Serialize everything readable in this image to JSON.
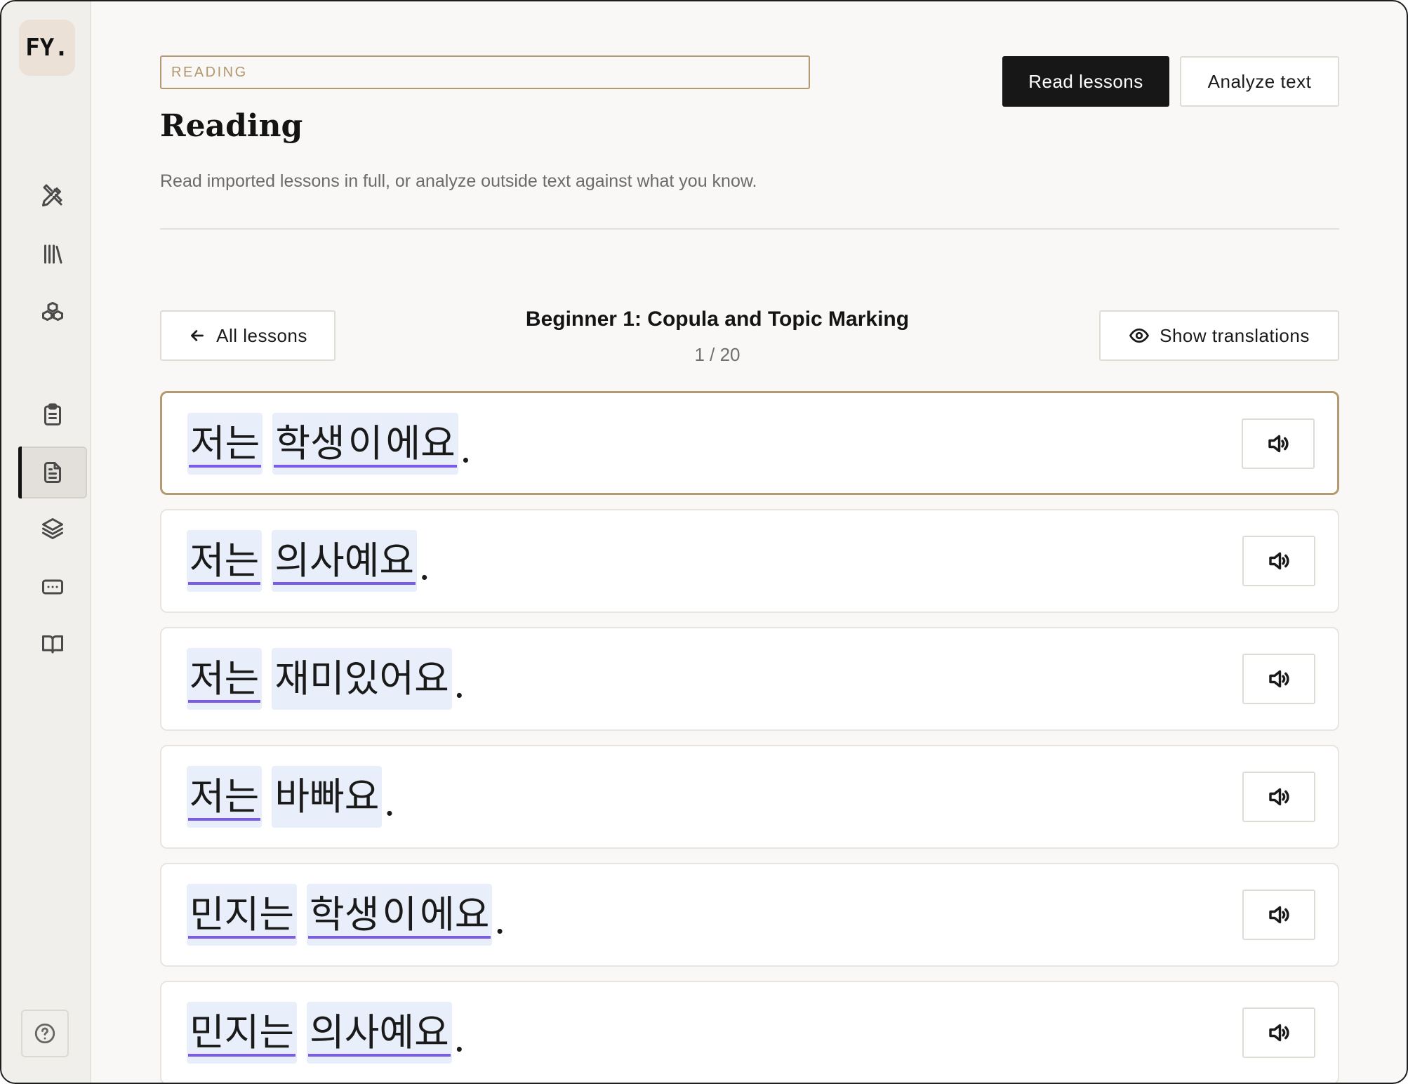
{
  "app": {
    "logo_text": "FY."
  },
  "sidebar": {
    "items": [
      {
        "icon": "pencil-ruler-icon",
        "active": false
      },
      {
        "icon": "library-icon",
        "active": false
      },
      {
        "icon": "boxes-icon",
        "active": false
      },
      {
        "icon": "clipboard-icon",
        "active": false
      },
      {
        "icon": "document-icon",
        "active": true
      },
      {
        "icon": "layers-icon",
        "active": false
      },
      {
        "icon": "keyboard-icon",
        "active": false
      },
      {
        "icon": "book-open-icon",
        "active": false
      }
    ],
    "help_icon": "help-circle-icon"
  },
  "header": {
    "tag": "READING",
    "title": "Reading",
    "subtitle": "Read imported lessons in full, or analyze outside text against what you know.",
    "primary_button": "Read lessons",
    "secondary_button": "Analyze text"
  },
  "lesson": {
    "back_label": "All lessons",
    "title": "Beginner 1: Copula and Topic Marking",
    "progress": "1 / 20",
    "translations_label": "Show translations"
  },
  "sentences": [
    {
      "words": [
        {
          "segs": [
            {
              "text": "저는",
              "known": true
            }
          ]
        },
        {
          "segs": [
            {
              "text": "학생",
              "known": true
            },
            {
              "text": "이",
              "known": true
            },
            {
              "text": "에요",
              "known": true
            }
          ]
        }
      ],
      "punct": "."
    },
    {
      "words": [
        {
          "segs": [
            {
              "text": "저는",
              "known": true
            }
          ]
        },
        {
          "segs": [
            {
              "text": "의사예요",
              "known": true
            }
          ]
        }
      ],
      "punct": "."
    },
    {
      "words": [
        {
          "segs": [
            {
              "text": "저는",
              "known": true
            }
          ]
        },
        {
          "segs": [
            {
              "text": "재미있어요",
              "known": false
            }
          ]
        }
      ],
      "punct": "."
    },
    {
      "words": [
        {
          "segs": [
            {
              "text": "저는",
              "known": true
            }
          ]
        },
        {
          "segs": [
            {
              "text": "바빠요",
              "known": false
            }
          ]
        }
      ],
      "punct": "."
    },
    {
      "words": [
        {
          "segs": [
            {
              "text": "민지는",
              "known": true
            }
          ]
        },
        {
          "segs": [
            {
              "text": "학생",
              "known": true
            },
            {
              "text": "이",
              "known": true
            },
            {
              "text": "에요",
              "known": true
            }
          ]
        }
      ],
      "punct": "."
    },
    {
      "words": [
        {
          "segs": [
            {
              "text": "민지는",
              "known": true
            }
          ]
        },
        {
          "segs": [
            {
              "text": "의사예요",
              "known": true
            }
          ]
        }
      ],
      "punct": "."
    }
  ],
  "colors": {
    "accent_border": "#b49a72",
    "known_underline": "#7b5ce6",
    "word_highlight": "#e9effa",
    "primary_button": "#171717"
  }
}
